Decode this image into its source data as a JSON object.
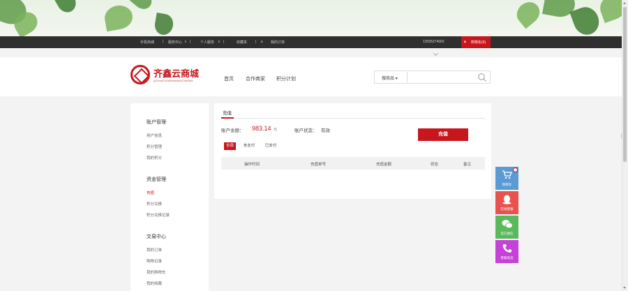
{
  "topbar": {
    "links": [
      "手机商城",
      "服务中心",
      "个人服务",
      "收藏夹",
      "我的订单"
    ],
    "phone": "13595274660",
    "cart": "购物车(0)"
  },
  "header": {
    "logo_text": "齐鑫云商城",
    "logo_sub": "QIXINYUNSHANGCHENG",
    "nav": [
      "首页",
      "合作商家",
      "积分计划"
    ],
    "search_category": "搜商品",
    "search_placeholder": ""
  },
  "sidebar": {
    "sections": [
      {
        "title": "账户管理",
        "items": [
          "用户信息",
          "积分管理",
          "我的积分"
        ]
      },
      {
        "title": "资金管理",
        "items": [
          "充值",
          "积分兑换",
          "积分兑换记录"
        ]
      },
      {
        "title": "交易中心",
        "items": [
          "我的订单",
          "购物记录",
          "我的购物车",
          "我的收藏"
        ]
      }
    ],
    "active_item": "充值"
  },
  "main": {
    "tab_title": "充值",
    "balance_label": "账户余额：",
    "balance_value": "983.14",
    "balance_unit": "元",
    "status_label": "账户状态：",
    "status_value": "有效",
    "recharge_button": "充值",
    "filter_tabs": [
      "全部",
      "未支付",
      "已支付"
    ],
    "active_filter": "全部",
    "table_headers": [
      "操作时间",
      "充值单号",
      "充值金额",
      "状态",
      "备注"
    ],
    "table_rows": []
  },
  "float_bar": [
    {
      "label": "购物车",
      "icon": "cart-icon",
      "color": "#5b9bd5"
    },
    {
      "label": "在线客服",
      "icon": "qq-icon",
      "color": "#e8524f"
    },
    {
      "label": "官方微信",
      "icon": "wechat-icon",
      "color": "#5cb85c"
    },
    {
      "label": "客服电话",
      "icon": "phone-icon",
      "color": "#c641d8"
    }
  ],
  "colors": {
    "brand": "#c8161d",
    "topbar": "#2f2f2f"
  }
}
